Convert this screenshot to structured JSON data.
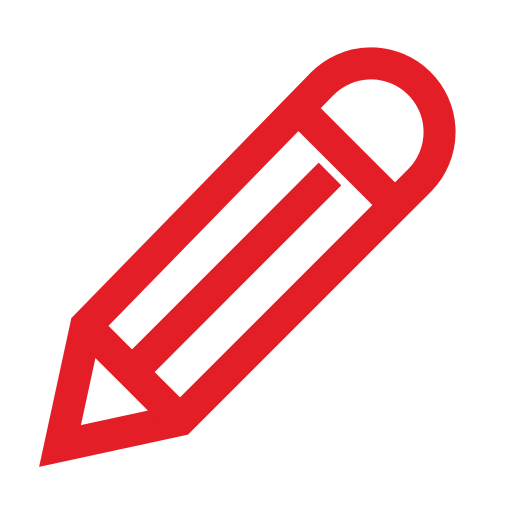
{
  "icon": {
    "name": "pencil-icon",
    "color": "#e41e26",
    "background": "#ffffff"
  }
}
